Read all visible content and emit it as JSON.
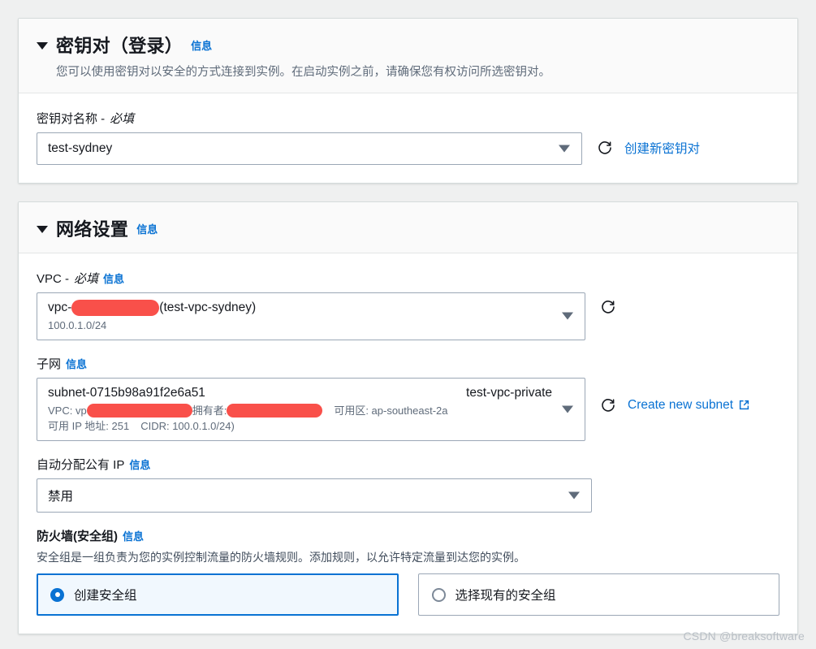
{
  "colors": {
    "accent": "#0972d3",
    "page_bg": "#eff0f0",
    "card_bg": "#ffffff",
    "header_bg": "#fafafa",
    "border": "#d5dbdb",
    "redaction": "#f9504a",
    "selected_tile_bg": "#f1f8fe",
    "muted_text": "#5f6b7a"
  },
  "keypair_section": {
    "caret_icon": "caret-down-icon",
    "title": "密钥对（登录）",
    "info_label": "信息",
    "description": "您可以使用密钥对以安全的方式连接到实例。在启动实例之前，请确保您有权访问所选密钥对。",
    "field": {
      "label_main": "密钥对名称 -",
      "label_required": "必填",
      "value": "test-sydney",
      "dropdown_icon": "chevron-down-icon"
    },
    "actions": {
      "refresh_icon": "refresh-icon",
      "create_link": "创建新密钥对"
    }
  },
  "network_section": {
    "caret_icon": "caret-down-icon",
    "title": "网络设置",
    "info_label": "信息",
    "vpc": {
      "label_main": "VPC -",
      "label_required": "必填",
      "info_label": "信息",
      "value_prefix": "vpc-",
      "value_redacted": true,
      "value_suffix": "(test-vpc-sydney)",
      "sub_value": "100.0.1.0/24",
      "dropdown_icon": "chevron-down-icon",
      "refresh_icon": "refresh-icon"
    },
    "subnet": {
      "label_main": "子网",
      "info_label": "信息",
      "id": "subnet-0715b98a91f2e6a51",
      "name": "test-vpc-private",
      "vpc_prefix": "VPC: vp",
      "owner_prefix": "拥有者:",
      "az_label": "可用区: ap-southeast-2a",
      "available_ips": "可用 IP 地址: 251",
      "cidr": "CIDR: 100.0.1.0/24)",
      "dropdown_icon": "chevron-down-icon",
      "refresh_icon": "refresh-icon",
      "create_link": "Create new subnet",
      "external_icon": "external-link-icon"
    },
    "auto_public_ip": {
      "label_main": "自动分配公有 IP",
      "info_label": "信息",
      "value": "禁用",
      "dropdown_icon": "chevron-down-icon"
    },
    "firewall": {
      "label_main": "防火墙(安全组)",
      "info_label": "信息",
      "description": "安全组是一组负责为您的实例控制流量的防火墙规则。添加规则，以允许特定流量到达您的实例。",
      "options": [
        {
          "label": "创建安全组",
          "selected": true
        },
        {
          "label": "选择现有的安全组",
          "selected": false
        }
      ]
    }
  },
  "watermark": "CSDN @breaksoftware"
}
